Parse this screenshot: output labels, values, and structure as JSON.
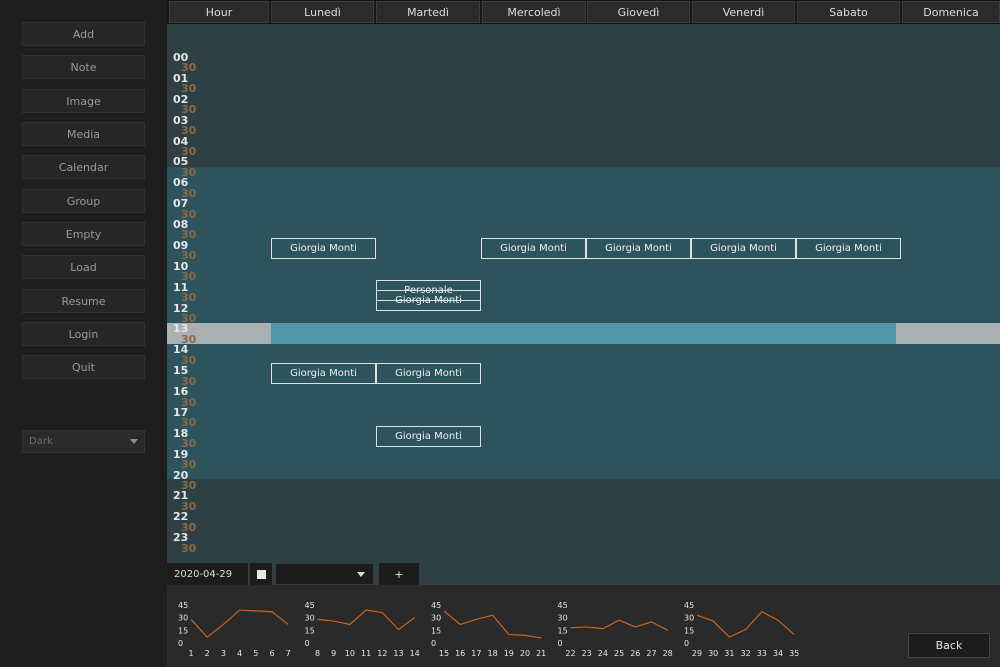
{
  "sidebar": {
    "buttons": [
      "Add",
      "Note",
      "Image",
      "Media",
      "Calendar",
      "Group",
      "Empty",
      "Load",
      "Resume",
      "Login",
      "Quit"
    ],
    "theme": "Dark"
  },
  "header": {
    "columns": [
      "Hour",
      "Lunedì",
      "Martedì",
      "Mercoledì",
      "Giovedì",
      "Venerdì",
      "Sabato",
      "Domenica"
    ]
  },
  "grid": {
    "hours": [
      "00",
      "01",
      "02",
      "03",
      "04",
      "05",
      "06",
      "07",
      "08",
      "09",
      "10",
      "11",
      "12",
      "13",
      "14",
      "15",
      "16",
      "17",
      "18",
      "19",
      "20",
      "21",
      "22",
      "23"
    ],
    "half_label": "30",
    "current_hour": "13",
    "colors": {
      "night": "#2f4045",
      "day": "#2d535c",
      "current_row": "#5196ab",
      "current_row_side": "#aab0b2",
      "hour_label": "#e6e6e6",
      "half_label": "#8a6a46",
      "accent_line": "#c8651e"
    },
    "events": [
      {
        "day": 1,
        "slot": 18,
        "label": "Giorgia Monti"
      },
      {
        "day": 3,
        "slot": 18,
        "label": "Giorgia Monti"
      },
      {
        "day": 4,
        "slot": 18,
        "label": "Giorgia Monti"
      },
      {
        "day": 5,
        "slot": 18,
        "label": "Giorgia Monti"
      },
      {
        "day": 6,
        "slot": 18,
        "label": "Giorgia Monti"
      },
      {
        "day": 2,
        "slot": 22,
        "label": "Personale"
      },
      {
        "day": 2,
        "slot": 23,
        "label": "Giorgia Monti"
      },
      {
        "day": 1,
        "slot": 30,
        "label": "Giorgia Monti"
      },
      {
        "day": 2,
        "slot": 30,
        "label": "Giorgia Monti"
      },
      {
        "day": 2,
        "slot": 36,
        "label": "Giorgia Monti"
      }
    ]
  },
  "toolbar": {
    "date": "2020-04-29",
    "add_label": "+"
  },
  "stats": {
    "y_ticks": [
      "45",
      "30",
      "15",
      "0"
    ],
    "groups": [
      {
        "x": [
          "1",
          "2",
          "3",
          "4",
          "5",
          "6",
          "7"
        ],
        "values": [
          28,
          7,
          22,
          39,
          38,
          37,
          22
        ]
      },
      {
        "x": [
          "8",
          "9",
          "10",
          "11",
          "12",
          "13",
          "14"
        ],
        "values": [
          28,
          26,
          22,
          39,
          36,
          16,
          30
        ]
      },
      {
        "x": [
          "15",
          "16",
          "17",
          "18",
          "19",
          "20",
          "21"
        ],
        "values": [
          38,
          22,
          28,
          33,
          10,
          9,
          6
        ]
      },
      {
        "x": [
          "22",
          "23",
          "24",
          "25",
          "26",
          "27",
          "28"
        ],
        "values": [
          18,
          19,
          17,
          27,
          19,
          25,
          15
        ]
      },
      {
        "x": [
          "29",
          "30",
          "31",
          "32",
          "33",
          "34",
          "35"
        ],
        "values": [
          33,
          26,
          7,
          16,
          37,
          27,
          10
        ]
      }
    ]
  },
  "footer": {
    "back_label": "Back"
  }
}
